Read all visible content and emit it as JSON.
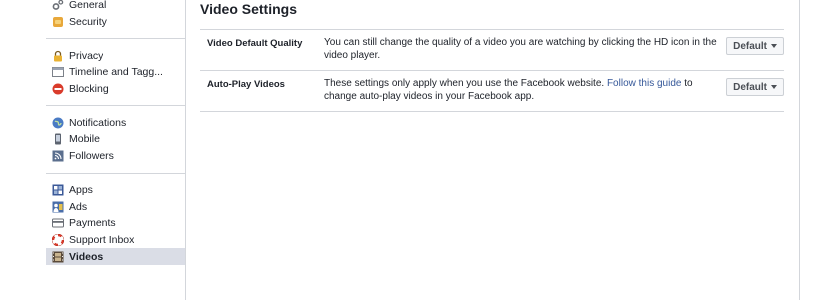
{
  "sidebar": {
    "groups": [
      [
        {
          "label": "General",
          "icon": "gears-icon"
        },
        {
          "label": "Security",
          "icon": "badge-icon"
        }
      ],
      [
        {
          "label": "Privacy",
          "icon": "lock-icon"
        },
        {
          "label": "Timeline and Tagg...",
          "icon": "timeline-icon"
        },
        {
          "label": "Blocking",
          "icon": "blocking-icon"
        }
      ],
      [
        {
          "label": "Notifications",
          "icon": "globe-icon"
        },
        {
          "label": "Mobile",
          "icon": "phone-icon"
        },
        {
          "label": "Followers",
          "icon": "rss-icon"
        }
      ],
      [
        {
          "label": "Apps",
          "icon": "apps-icon"
        },
        {
          "label": "Ads",
          "icon": "ads-icon"
        },
        {
          "label": "Payments",
          "icon": "card-icon"
        },
        {
          "label": "Support Inbox",
          "icon": "lifebuoy-icon"
        },
        {
          "label": "Videos",
          "icon": "film-icon",
          "selected": true
        }
      ]
    ]
  },
  "main": {
    "title": "Video Settings",
    "rows": [
      {
        "label": "Video Default Quality",
        "desc": "You can still change the quality of a video you are watching by clicking the HD icon in the video player.",
        "control": "Default"
      },
      {
        "label": "Auto-Play Videos",
        "desc_before": "These settings only apply when you use the Facebook website. ",
        "desc_link": "Follow this guide",
        "desc_after": " to change auto-play videos in your Facebook app.",
        "control": "Default"
      }
    ]
  },
  "colors": {
    "link": "#365899",
    "border": "#d3d6db",
    "selected_bg": "#dadde6"
  }
}
